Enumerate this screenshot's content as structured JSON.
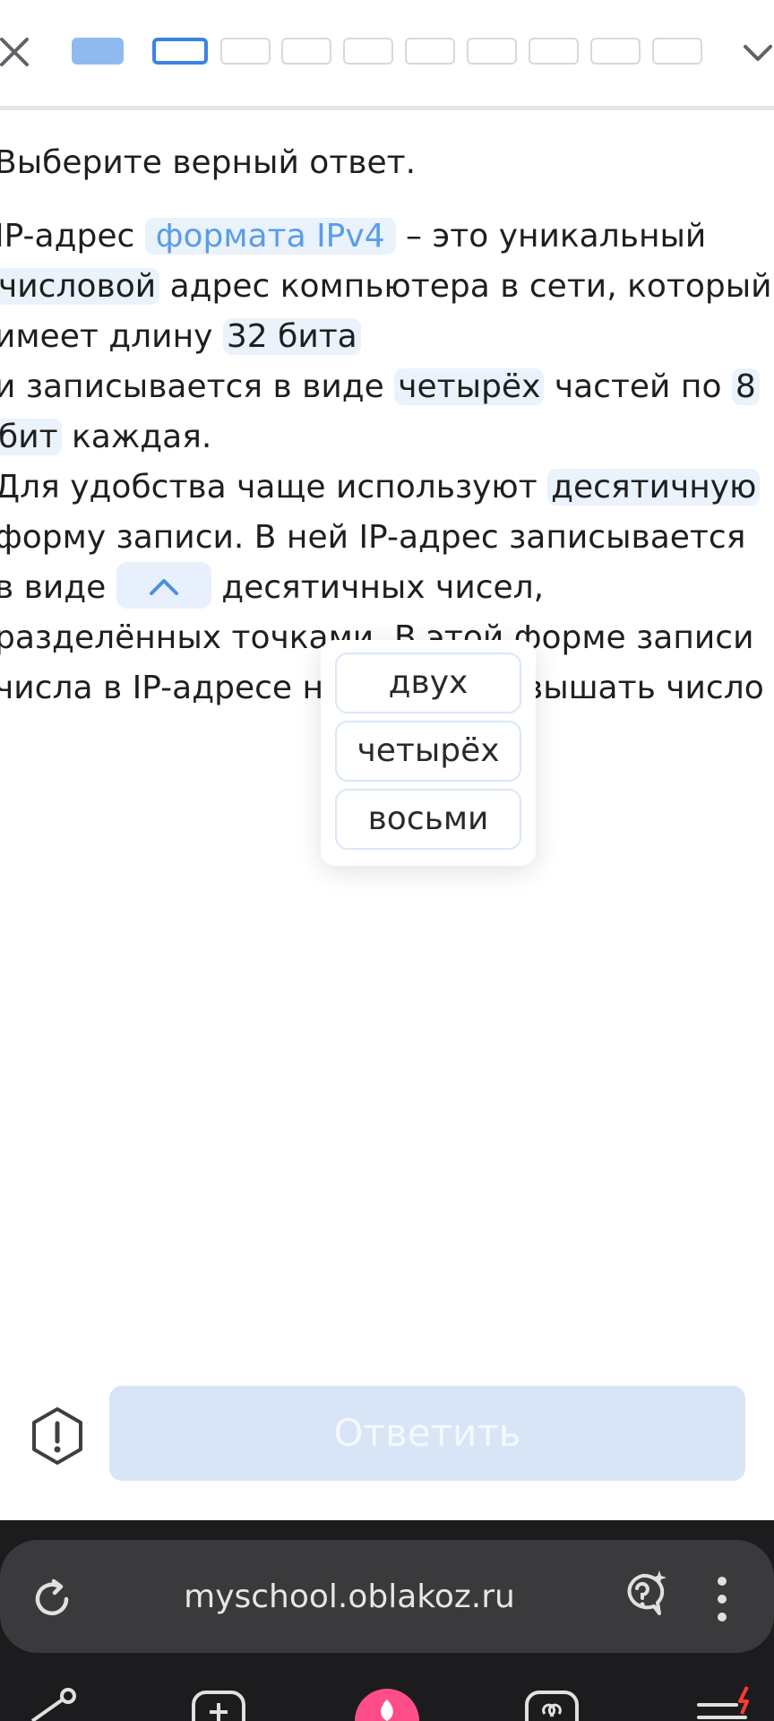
{
  "progress": {
    "total_steps": 10,
    "current_step": 2
  },
  "instruction": "Выберите верный ответ.",
  "question": {
    "t1": "IP-адрес ",
    "hl1": "формата IPv4",
    "t2": " – это уникальный ",
    "hl2": "числовой",
    "t3": " адрес компьютера в сети, который имеет длину ",
    "hl3": "32 бита",
    "t4": "и записывается в виде ",
    "hl4": "четырёх",
    "t5": " частей по ",
    "hl5": "8",
    "hl6": "бит",
    "t6": " каждая.",
    "t7": "Для удобства чаще используют ",
    "hl7": "десятичную",
    "t8": " форму записи. В ней IP-адрес записывается в виде ",
    "t9": " десятичных чисел, разделённых точками. В этой форме записи числа в IP-адресе не могут превышать число"
  },
  "dropdown": {
    "options": [
      "двух",
      "четырёх",
      "восьми"
    ]
  },
  "actions": {
    "answer_label": "Ответить"
  },
  "browser": {
    "url": "myschool.oblakoz.ru"
  },
  "colors": {
    "accent": "#3b82e6",
    "highlight_bg": "#eaf2fc",
    "answer_disabled": "#d7e5f7",
    "chrome_bg": "#1c1c1e"
  }
}
